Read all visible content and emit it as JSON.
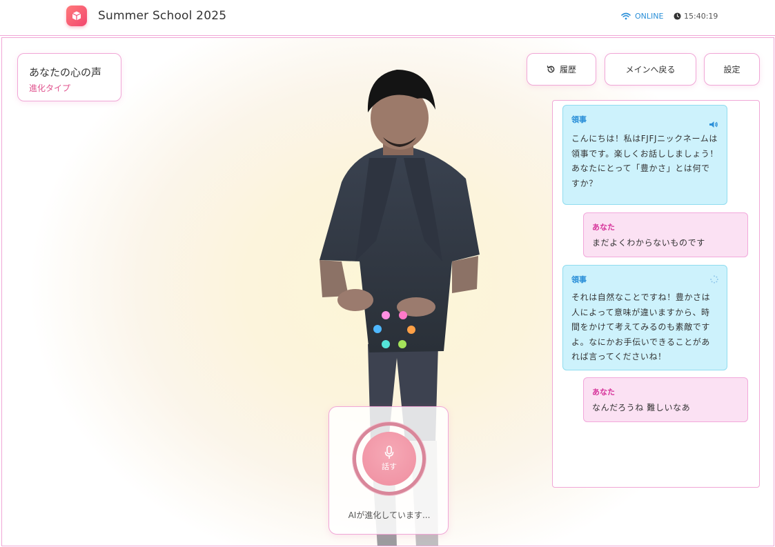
{
  "header": {
    "app_title": "Summer School 2025",
    "connection_status": "ONLINE",
    "time": "15:40:19"
  },
  "profile": {
    "title": "あなたの心の声",
    "subtitle": "進化タイプ"
  },
  "toolbar": {
    "history_label": "履歴",
    "main_label": "メインへ戻る",
    "settings_label": "設定"
  },
  "chat": {
    "messages": [
      {
        "speaker": "領事",
        "role": "ai",
        "text": "こんにちは！私はFJFJニックネームは領事です。楽しくお話ししましょう！ あなたにとって「豊かさ」とは何ですか？",
        "status_icon": "speaker-icon"
      },
      {
        "speaker": "あなた",
        "role": "user",
        "text": "まだよくわからないものです"
      },
      {
        "speaker": "領事",
        "role": "ai",
        "text": "それは自然なことですね！豊かさは人によって意味が違いますから、時間をかけて考えてみるのも素敵ですよ。なにかお手伝いできることがあれば言ってくださいね！",
        "status_icon": "loading-spinner-icon"
      },
      {
        "speaker": "あなた",
        "role": "user",
        "text": "なんだろうね 難しいなあ"
      }
    ]
  },
  "mic": {
    "button_label": "話す",
    "status_text": "AIが進化しています..."
  },
  "colors": {
    "accent_pink": "#f0a6d6",
    "ai_bubble": "#cdf2fc",
    "user_bubble": "#fbe1f3",
    "online_blue": "#2a8fd8"
  }
}
